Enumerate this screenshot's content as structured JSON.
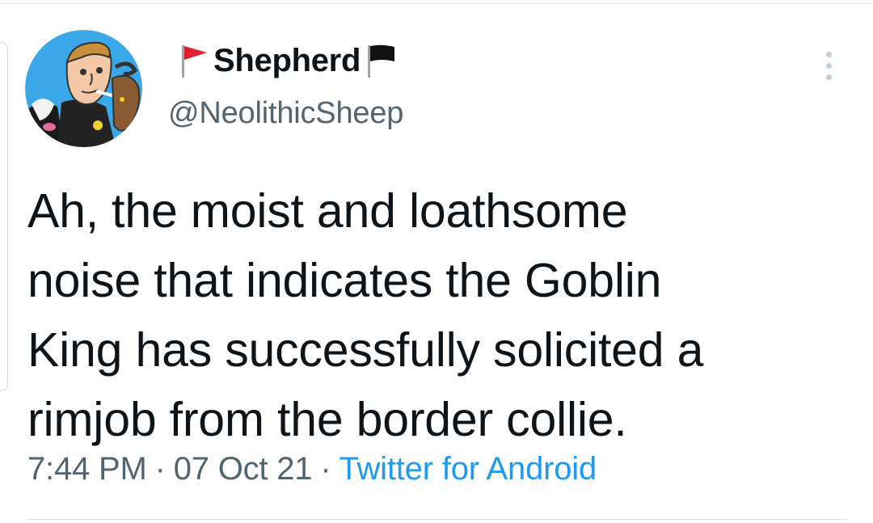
{
  "author": {
    "flag_left": "red-flag",
    "display_name": "Shepherd",
    "flag_right": "black-flag",
    "handle": "@NeolithicSheep"
  },
  "tweet": {
    "lines": [
      "Ah, the moist and loathsome",
      "noise that indicates the Goblin",
      "King has successfully solicited a",
      "rimjob from the border collie."
    ]
  },
  "meta": {
    "time": "7:44 PM",
    "separator": "·",
    "date": "07 Oct 21",
    "source": "Twitter for Android"
  },
  "colors": {
    "text": "#0f1419",
    "secondary": "#536471",
    "link": "#1d9bf0",
    "avatar_bg": "#3aa8e8"
  }
}
